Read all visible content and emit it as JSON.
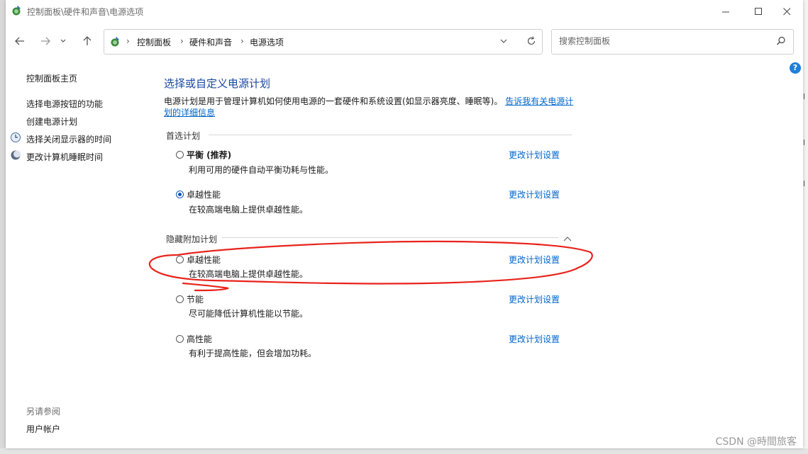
{
  "window": {
    "title": "控制面板\\硬件和声音\\电源选项"
  },
  "address": {
    "crumbs": [
      "控制面板",
      "硬件和声音",
      "电源选项"
    ],
    "separator": "›"
  },
  "search": {
    "placeholder": "搜索控制面板",
    "value": ""
  },
  "sidebar": {
    "home": "控制面板主页",
    "links": [
      "选择电源按钮的功能",
      "创建电源计划",
      "选择关闭显示器的时间",
      "更改计算机睡眠时间"
    ],
    "see_also_heading": "另请参阅",
    "see_also": [
      "用户帐户"
    ]
  },
  "main": {
    "title": "选择或自定义电源计划",
    "intro": "电源计划是用于管理计算机如何使用电源的一套硬件和系统设置(如显示器亮度、睡眠等)。",
    "intro_link_1": "告诉我有关电源计",
    "intro_link_2": "划的详细信息",
    "preferred_heading": "首选计划",
    "hidden_heading": "隐藏附加计划",
    "change_link": "更改计划设置",
    "preferred_plans": [
      {
        "name": "平衡 (推荐)",
        "desc": "利用可用的硬件自动平衡功耗与性能。",
        "selected": false
      },
      {
        "name": "卓越性能",
        "desc": "在较高端电脑上提供卓越性能。",
        "selected": true
      }
    ],
    "hidden_plans": [
      {
        "name": "卓越性能",
        "desc": "在较高端电脑上提供卓越性能。",
        "selected": false
      },
      {
        "name": "节能",
        "desc": "尽可能降低计算机性能以节能。",
        "selected": false
      },
      {
        "name": "高性能",
        "desc": "有利于提高性能，但会增加功耗。",
        "selected": false
      }
    ]
  },
  "watermark": "CSDN @時間旅客",
  "colors": {
    "accent": "#0d57b8",
    "link": "#0066cc",
    "title": "#1a47a0",
    "annotation": "#e8231b"
  }
}
